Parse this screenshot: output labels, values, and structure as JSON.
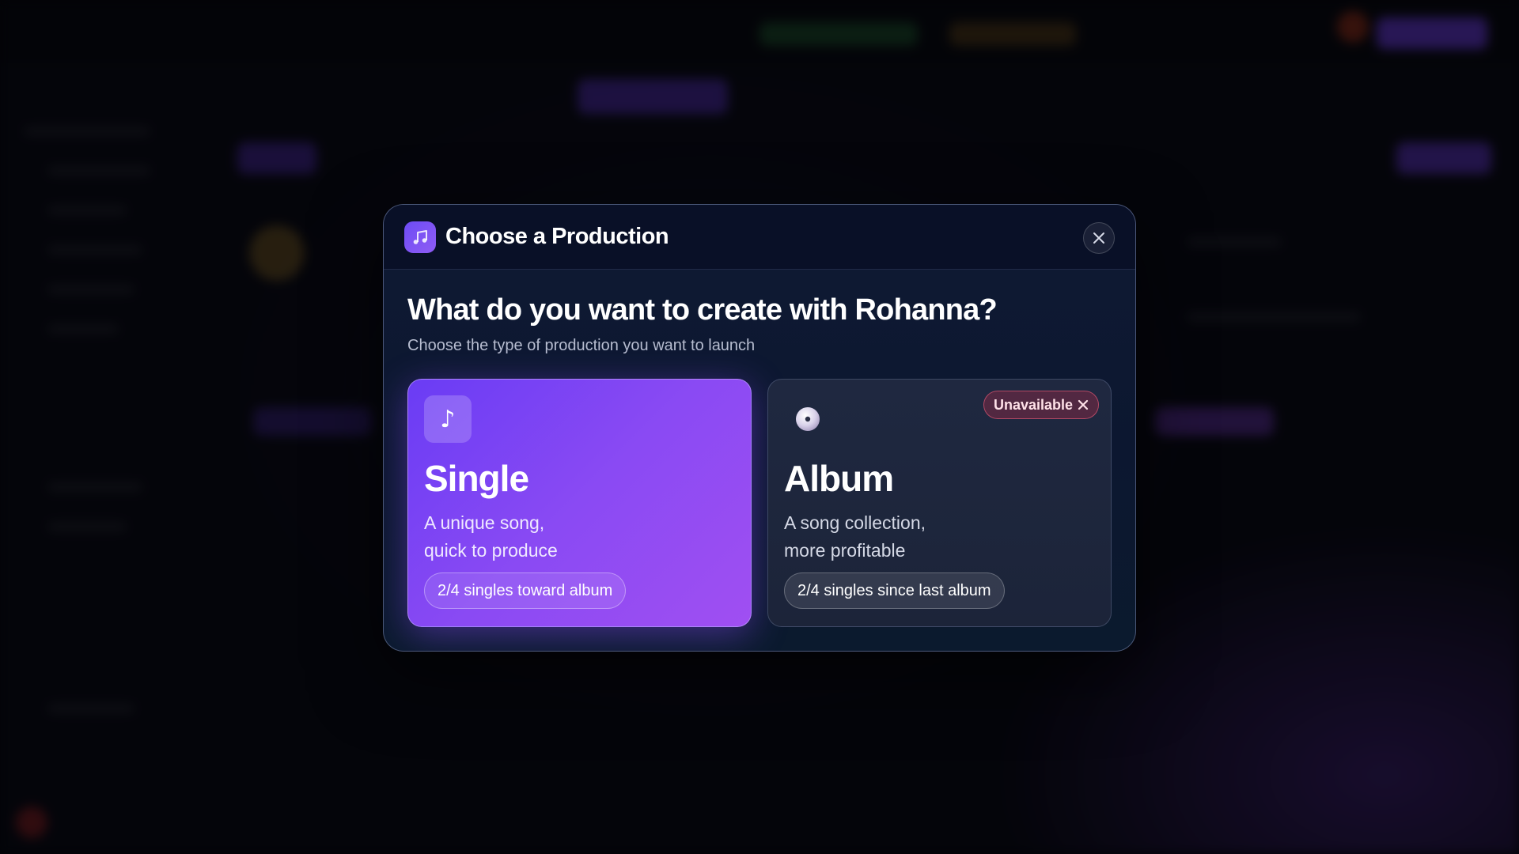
{
  "modal": {
    "title": "Choose a Production",
    "question": "What do you want to create with Rohanna?",
    "subtitle": "Choose the type of production you want to launch",
    "header_icon": "music-icon",
    "close_icon": "close-icon"
  },
  "options": [
    {
      "id": "single",
      "icon": "music-note-icon",
      "icon_glyph": "♪",
      "title": "Single",
      "desc_line1": "A unique song,",
      "desc_line2": "quick to produce",
      "progress_label": "2/4 singles toward album",
      "selected": true,
      "accent": "#8a4af3"
    },
    {
      "id": "album",
      "icon": "disc-icon",
      "title": "Album",
      "desc_line1": "A song collection,",
      "desc_line2": "more profitable",
      "progress_label": "2/4 singles since last album",
      "badge": "Unavailable",
      "badge_icon": "close-icon",
      "available": false,
      "badge_color": "#e65a78"
    }
  ],
  "colors": {
    "modal_bg": "#0f1a33",
    "single_gradient_start": "#6a3cf4",
    "single_gradient_end": "#a04ff2",
    "album_bg": "#1f2840"
  }
}
